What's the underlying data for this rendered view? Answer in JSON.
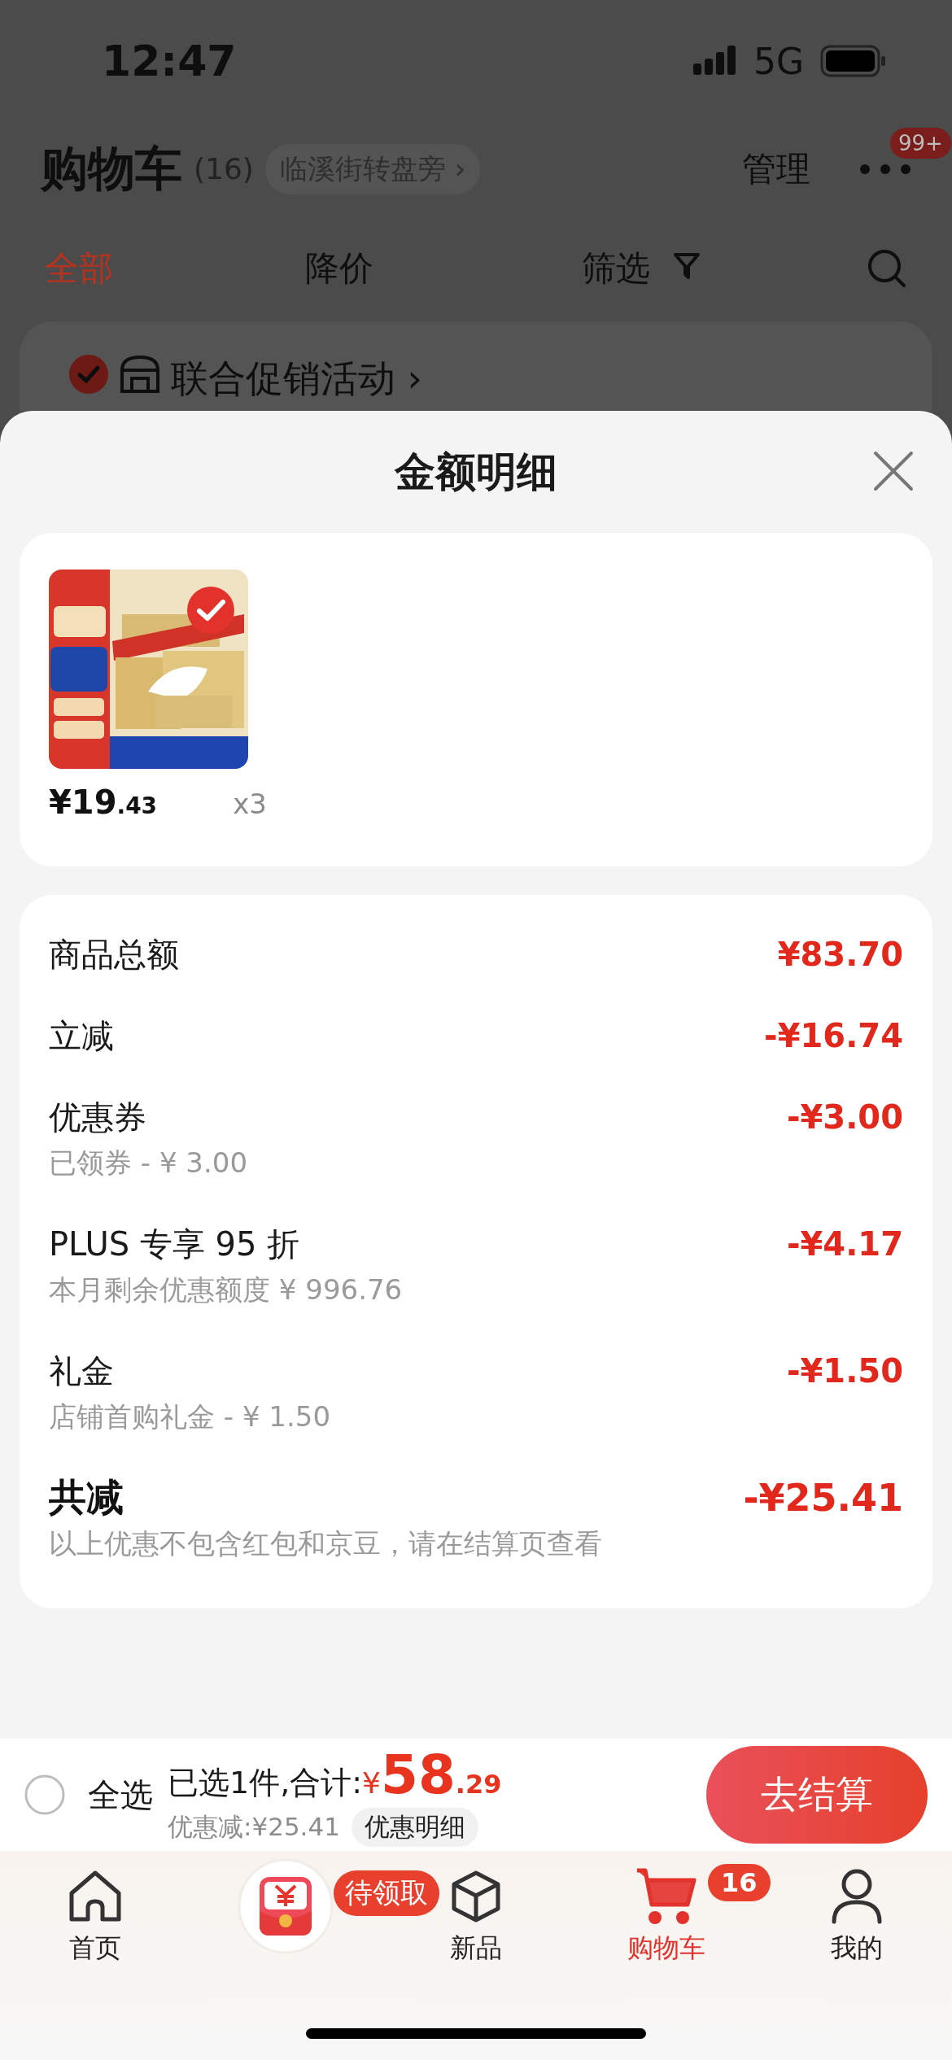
{
  "status_bar": {
    "time": "12:47",
    "network": "5G"
  },
  "header": {
    "title": "购物车",
    "count": "(16)",
    "location": "临溪街转盘旁 ›",
    "manage": "管理",
    "more_badge": "99+"
  },
  "filter_tabs": [
    {
      "label": "全部",
      "selected": true,
      "kind": "plain"
    },
    {
      "label": "降价",
      "selected": false,
      "kind": "plain"
    },
    {
      "label": "筛选",
      "selected": false,
      "kind": "filter"
    }
  ],
  "promo": {
    "label": "联合促销活动 ›",
    "checked": true
  },
  "sheet": {
    "title": "金额明细",
    "items": [
      {
        "price": "¥19",
        "price_decimal": ".43",
        "quantity": "x3",
        "selected": true
      }
    ],
    "summary": [
      {
        "kind": "row",
        "label": "商品总额",
        "amount": "¥83.70"
      },
      {
        "kind": "row",
        "label": "立减",
        "amount": "-¥16.74"
      },
      {
        "kind": "row",
        "label": "优惠券",
        "amount": "-¥3.00",
        "note": "已领券 - ¥ 3.00"
      },
      {
        "kind": "row",
        "label": "PLUS 专享 95 折",
        "amount": "-¥4.17",
        "note": "本月剩余优惠额度 ¥ 996.76"
      },
      {
        "kind": "row",
        "label": "礼金",
        "amount": "-¥1.50",
        "note": "店铺首购礼金 - ¥ 1.50"
      },
      {
        "kind": "total",
        "label": "共减",
        "amount": "-¥25.41",
        "note": "以上优惠不包含红包和京豆，请在结算页查看"
      }
    ]
  },
  "checkout_bar": {
    "select_all": {
      "label": "全选",
      "checked": false
    },
    "summary": "已选1件,合计:",
    "currency": "¥",
    "total": "58",
    "total_decimal": ".29",
    "discount": "优惠减:¥25.41",
    "detail_button": "优惠明细",
    "checkout_button": "去结算"
  },
  "tab_bar": [
    {
      "kind": "home",
      "label": "首页",
      "selected": false
    },
    {
      "kind": "redpacket",
      "badge": "待领取",
      "selected": false
    },
    {
      "kind": "new",
      "label": "新品",
      "selected": false
    },
    {
      "kind": "cart",
      "label": "购物车",
      "badge": "16",
      "selected": true
    },
    {
      "kind": "me",
      "label": "我的",
      "selected": false
    }
  ]
}
